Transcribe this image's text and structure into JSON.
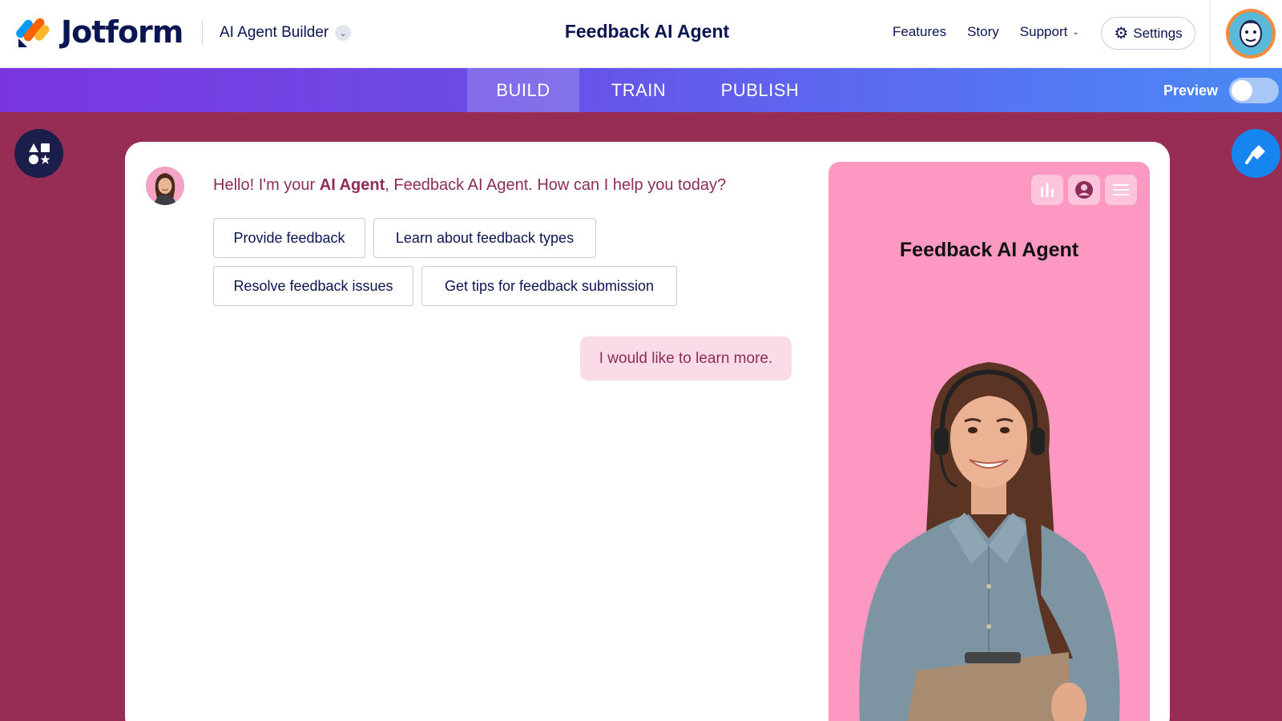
{
  "header": {
    "logo_text": "Jotform",
    "product_name": "AI Agent Builder",
    "page_title": "Feedback AI Agent",
    "nav": [
      "Features",
      "Story",
      "Support"
    ],
    "settings_label": "Settings"
  },
  "tabs": {
    "build": "BUILD",
    "train": "TRAIN",
    "publish": "PUBLISH",
    "active": "BUILD"
  },
  "preview": {
    "label": "Preview",
    "enabled": false
  },
  "chat": {
    "greeting_prefix": "Hello! I'm your ",
    "greeting_bold": "AI Agent",
    "greeting_suffix": ", Feedback AI Agent. How can I help you today?",
    "suggestions": [
      "Provide feedback",
      "Learn about feedback types",
      "Resolve feedback issues",
      "Get tips for feedback submission"
    ],
    "user_message": "I would like to learn more."
  },
  "preview_pane": {
    "title": "Feedback AI Agent",
    "icons": [
      "bar-chart-icon",
      "user-circle-icon",
      "menu-icon"
    ]
  },
  "colors": {
    "background": "#972c55",
    "pane": "#fd98c2",
    "accent_text": "#8b2d58",
    "navy": "#0a1551",
    "tab_gradient_start": "#7b35e0",
    "tab_gradient_end": "#4a8af5"
  }
}
